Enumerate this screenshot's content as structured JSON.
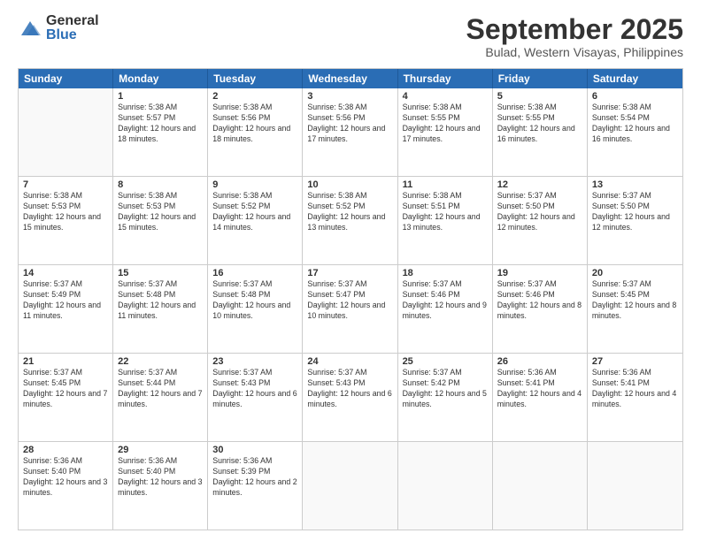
{
  "logo": {
    "general": "General",
    "blue": "Blue"
  },
  "title": "September 2025",
  "subtitle": "Bulad, Western Visayas, Philippines",
  "days": [
    "Sunday",
    "Monday",
    "Tuesday",
    "Wednesday",
    "Thursday",
    "Friday",
    "Saturday"
  ],
  "weeks": [
    [
      {
        "day": "",
        "sunrise": "",
        "sunset": "",
        "daylight": ""
      },
      {
        "day": "1",
        "sunrise": "Sunrise: 5:38 AM",
        "sunset": "Sunset: 5:57 PM",
        "daylight": "Daylight: 12 hours and 18 minutes."
      },
      {
        "day": "2",
        "sunrise": "Sunrise: 5:38 AM",
        "sunset": "Sunset: 5:56 PM",
        "daylight": "Daylight: 12 hours and 18 minutes."
      },
      {
        "day": "3",
        "sunrise": "Sunrise: 5:38 AM",
        "sunset": "Sunset: 5:56 PM",
        "daylight": "Daylight: 12 hours and 17 minutes."
      },
      {
        "day": "4",
        "sunrise": "Sunrise: 5:38 AM",
        "sunset": "Sunset: 5:55 PM",
        "daylight": "Daylight: 12 hours and 17 minutes."
      },
      {
        "day": "5",
        "sunrise": "Sunrise: 5:38 AM",
        "sunset": "Sunset: 5:55 PM",
        "daylight": "Daylight: 12 hours and 16 minutes."
      },
      {
        "day": "6",
        "sunrise": "Sunrise: 5:38 AM",
        "sunset": "Sunset: 5:54 PM",
        "daylight": "Daylight: 12 hours and 16 minutes."
      }
    ],
    [
      {
        "day": "7",
        "sunrise": "Sunrise: 5:38 AM",
        "sunset": "Sunset: 5:53 PM",
        "daylight": "Daylight: 12 hours and 15 minutes."
      },
      {
        "day": "8",
        "sunrise": "Sunrise: 5:38 AM",
        "sunset": "Sunset: 5:53 PM",
        "daylight": "Daylight: 12 hours and 15 minutes."
      },
      {
        "day": "9",
        "sunrise": "Sunrise: 5:38 AM",
        "sunset": "Sunset: 5:52 PM",
        "daylight": "Daylight: 12 hours and 14 minutes."
      },
      {
        "day": "10",
        "sunrise": "Sunrise: 5:38 AM",
        "sunset": "Sunset: 5:52 PM",
        "daylight": "Daylight: 12 hours and 13 minutes."
      },
      {
        "day": "11",
        "sunrise": "Sunrise: 5:38 AM",
        "sunset": "Sunset: 5:51 PM",
        "daylight": "Daylight: 12 hours and 13 minutes."
      },
      {
        "day": "12",
        "sunrise": "Sunrise: 5:37 AM",
        "sunset": "Sunset: 5:50 PM",
        "daylight": "Daylight: 12 hours and 12 minutes."
      },
      {
        "day": "13",
        "sunrise": "Sunrise: 5:37 AM",
        "sunset": "Sunset: 5:50 PM",
        "daylight": "Daylight: 12 hours and 12 minutes."
      }
    ],
    [
      {
        "day": "14",
        "sunrise": "Sunrise: 5:37 AM",
        "sunset": "Sunset: 5:49 PM",
        "daylight": "Daylight: 12 hours and 11 minutes."
      },
      {
        "day": "15",
        "sunrise": "Sunrise: 5:37 AM",
        "sunset": "Sunset: 5:48 PM",
        "daylight": "Daylight: 12 hours and 11 minutes."
      },
      {
        "day": "16",
        "sunrise": "Sunrise: 5:37 AM",
        "sunset": "Sunset: 5:48 PM",
        "daylight": "Daylight: 12 hours and 10 minutes."
      },
      {
        "day": "17",
        "sunrise": "Sunrise: 5:37 AM",
        "sunset": "Sunset: 5:47 PM",
        "daylight": "Daylight: 12 hours and 10 minutes."
      },
      {
        "day": "18",
        "sunrise": "Sunrise: 5:37 AM",
        "sunset": "Sunset: 5:46 PM",
        "daylight": "Daylight: 12 hours and 9 minutes."
      },
      {
        "day": "19",
        "sunrise": "Sunrise: 5:37 AM",
        "sunset": "Sunset: 5:46 PM",
        "daylight": "Daylight: 12 hours and 8 minutes."
      },
      {
        "day": "20",
        "sunrise": "Sunrise: 5:37 AM",
        "sunset": "Sunset: 5:45 PM",
        "daylight": "Daylight: 12 hours and 8 minutes."
      }
    ],
    [
      {
        "day": "21",
        "sunrise": "Sunrise: 5:37 AM",
        "sunset": "Sunset: 5:45 PM",
        "daylight": "Daylight: 12 hours and 7 minutes."
      },
      {
        "day": "22",
        "sunrise": "Sunrise: 5:37 AM",
        "sunset": "Sunset: 5:44 PM",
        "daylight": "Daylight: 12 hours and 7 minutes."
      },
      {
        "day": "23",
        "sunrise": "Sunrise: 5:37 AM",
        "sunset": "Sunset: 5:43 PM",
        "daylight": "Daylight: 12 hours and 6 minutes."
      },
      {
        "day": "24",
        "sunrise": "Sunrise: 5:37 AM",
        "sunset": "Sunset: 5:43 PM",
        "daylight": "Daylight: 12 hours and 6 minutes."
      },
      {
        "day": "25",
        "sunrise": "Sunrise: 5:37 AM",
        "sunset": "Sunset: 5:42 PM",
        "daylight": "Daylight: 12 hours and 5 minutes."
      },
      {
        "day": "26",
        "sunrise": "Sunrise: 5:36 AM",
        "sunset": "Sunset: 5:41 PM",
        "daylight": "Daylight: 12 hours and 4 minutes."
      },
      {
        "day": "27",
        "sunrise": "Sunrise: 5:36 AM",
        "sunset": "Sunset: 5:41 PM",
        "daylight": "Daylight: 12 hours and 4 minutes."
      }
    ],
    [
      {
        "day": "28",
        "sunrise": "Sunrise: 5:36 AM",
        "sunset": "Sunset: 5:40 PM",
        "daylight": "Daylight: 12 hours and 3 minutes."
      },
      {
        "day": "29",
        "sunrise": "Sunrise: 5:36 AM",
        "sunset": "Sunset: 5:40 PM",
        "daylight": "Daylight: 12 hours and 3 minutes."
      },
      {
        "day": "30",
        "sunrise": "Sunrise: 5:36 AM",
        "sunset": "Sunset: 5:39 PM",
        "daylight": "Daylight: 12 hours and 2 minutes."
      },
      {
        "day": "",
        "sunrise": "",
        "sunset": "",
        "daylight": ""
      },
      {
        "day": "",
        "sunrise": "",
        "sunset": "",
        "daylight": ""
      },
      {
        "day": "",
        "sunrise": "",
        "sunset": "",
        "daylight": ""
      },
      {
        "day": "",
        "sunrise": "",
        "sunset": "",
        "daylight": ""
      }
    ]
  ]
}
